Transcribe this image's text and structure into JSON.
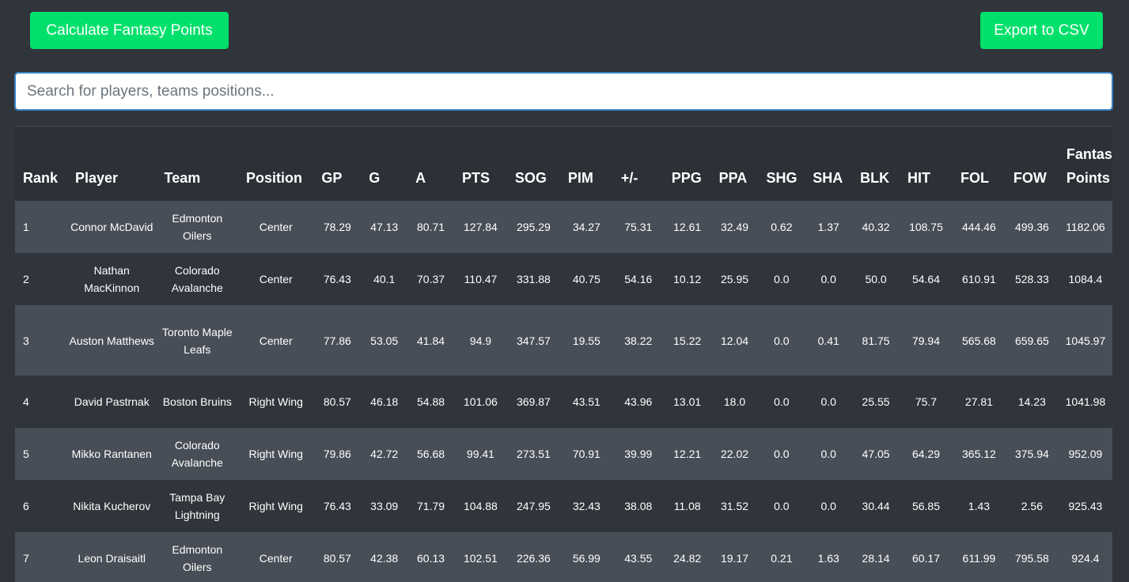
{
  "toolbar": {
    "calculate_label": "Calculate Fantasy Points",
    "export_label": "Export to CSV"
  },
  "search": {
    "placeholder": "Search for players, teams positions...",
    "value": ""
  },
  "table": {
    "columns": [
      "Rank",
      "Player",
      "Team",
      "Position",
      "GP",
      "G",
      "A",
      "PTS",
      "SOG",
      "PIM",
      "+/-",
      "PPG",
      "PPA",
      "SHG",
      "SHA",
      "BLK",
      "HIT",
      "FOL",
      "FOW",
      "Fantasy Points"
    ],
    "rows": [
      [
        "1",
        "Connor McDavid",
        "Edmonton Oilers",
        "Center",
        "78.29",
        "47.13",
        "80.71",
        "127.84",
        "295.29",
        "34.27",
        "75.31",
        "12.61",
        "32.49",
        "0.62",
        "1.37",
        "40.32",
        "108.75",
        "444.46",
        "499.36",
        "1182.06"
      ],
      [
        "2",
        "Nathan MacKinnon",
        "Colorado Avalanche",
        "Center",
        "76.43",
        "40.1",
        "70.37",
        "110.47",
        "331.88",
        "40.75",
        "54.16",
        "10.12",
        "25.95",
        "0.0",
        "0.0",
        "50.0",
        "54.64",
        "610.91",
        "528.33",
        "1084.4"
      ],
      [
        "3",
        "Auston Matthews",
        "Toronto Maple Leafs",
        "Center",
        "77.86",
        "53.05",
        "41.84",
        "94.9",
        "347.57",
        "19.55",
        "38.22",
        "15.22",
        "12.04",
        "0.0",
        "0.41",
        "81.75",
        "79.94",
        "565.68",
        "659.65",
        "1045.97"
      ],
      [
        "4",
        "David Pastrnak",
        "Boston Bruins",
        "Right Wing",
        "80.57",
        "46.18",
        "54.88",
        "101.06",
        "369.87",
        "43.51",
        "43.96",
        "13.01",
        "18.0",
        "0.0",
        "0.0",
        "25.55",
        "75.7",
        "27.81",
        "14.23",
        "1041.98"
      ],
      [
        "5",
        "Mikko Rantanen",
        "Colorado Avalanche",
        "Right Wing",
        "79.86",
        "42.72",
        "56.68",
        "99.41",
        "273.51",
        "70.91",
        "39.99",
        "12.21",
        "22.02",
        "0.0",
        "0.0",
        "47.05",
        "64.29",
        "365.12",
        "375.94",
        "952.09"
      ],
      [
        "6",
        "Nikita Kucherov",
        "Tampa Bay Lightning",
        "Right Wing",
        "76.43",
        "33.09",
        "71.79",
        "104.88",
        "247.95",
        "32.43",
        "38.08",
        "11.08",
        "31.52",
        "0.0",
        "0.0",
        "30.44",
        "56.85",
        "1.43",
        "2.56",
        "925.43"
      ],
      [
        "7",
        "Leon Draisaitl",
        "Edmonton Oilers",
        "Center",
        "80.57",
        "42.38",
        "60.13",
        "102.51",
        "226.36",
        "56.99",
        "43.55",
        "24.82",
        "19.17",
        "0.21",
        "1.63",
        "28.14",
        "60.17",
        "611.99",
        "795.58",
        "924.4"
      ]
    ]
  },
  "colors": {
    "background": "#30343b",
    "accent_button": "#00e06b",
    "row_stripe": "#484e57",
    "header_bg": "#2c3037"
  }
}
